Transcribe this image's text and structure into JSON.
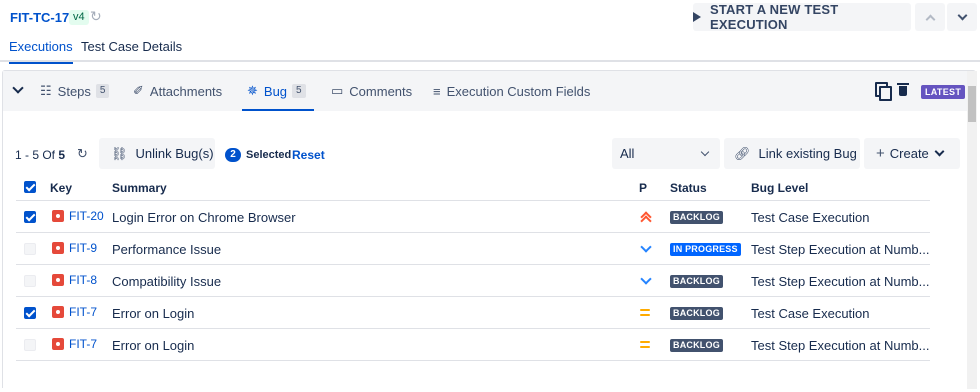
{
  "header": {
    "test_case_key": "FIT-TC-17",
    "version": "v4",
    "start_button_label": "START A NEW TEST EXECUTION",
    "tabs": [
      {
        "label": "Executions",
        "active": true
      },
      {
        "label": "Test Case Details",
        "active": false
      }
    ]
  },
  "panel": {
    "tabs": [
      {
        "label": "Steps",
        "count": "5",
        "icon": "steps-icon"
      },
      {
        "label": "Attachments",
        "count": "",
        "icon": "paperclip-icon"
      },
      {
        "label": "Bug",
        "count": "5",
        "icon": "bug-icon",
        "active": true
      },
      {
        "label": "Comments",
        "count": "",
        "icon": "comment-icon"
      },
      {
        "label": "Execution Custom Fields",
        "count": "",
        "icon": "custom-fields-icon"
      }
    ],
    "latest_badge": "LATEST"
  },
  "toolbar": {
    "range_prefix": "1 - 5 Of",
    "range_total": "5",
    "unlink_label": "Unlink Bug(s)",
    "selected_count": "2",
    "selected_label": "Selected",
    "reset_label": "Reset",
    "filter_value": "All",
    "link_existing_label": "Link existing Bug",
    "create_label": "Create"
  },
  "table": {
    "headers": {
      "key": "Key",
      "summary": "Summary",
      "priority": "P",
      "status": "Status",
      "bug_level": "Bug Level"
    },
    "rows": [
      {
        "checked": true,
        "key": "FIT-20",
        "summary": "Login Error on Chrome Browser",
        "priority": "highest",
        "status": "BACKLOG",
        "bug_level": "Test Case Execution"
      },
      {
        "checked": false,
        "key": "FIT-9",
        "summary": "Performance Issue",
        "priority": "low",
        "status": "IN PROGRESS",
        "bug_level": "Test Step Execution at Numb..."
      },
      {
        "checked": false,
        "key": "FIT-8",
        "summary": "Compatibility Issue",
        "priority": "low",
        "status": "BACKLOG",
        "bug_level": "Test Step Execution at Numb..."
      },
      {
        "checked": true,
        "key": "FIT-7",
        "summary": "Error on Login",
        "priority": "medium",
        "status": "BACKLOG",
        "bug_level": "Test Case Execution"
      },
      {
        "checked": false,
        "key": "FIT-7",
        "summary": "Error on Login",
        "priority": "medium",
        "status": "BACKLOG",
        "bug_level": "Test Step Execution at Numb..."
      }
    ]
  },
  "colors": {
    "brand_blue": "#0052cc",
    "bug_red": "#e5493a",
    "backlog_badge": "#42526e",
    "in_progress_badge": "#0065ff",
    "latest_badge": "#6554c0"
  }
}
